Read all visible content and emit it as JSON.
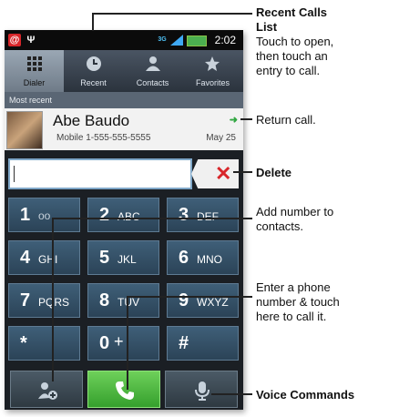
{
  "status_bar": {
    "time": "2:02",
    "network": "3G"
  },
  "tabs": [
    {
      "label": "Dialer",
      "icon": "dialpad-icon",
      "active": true
    },
    {
      "label": "Recent",
      "icon": "clock-icon",
      "active": false
    },
    {
      "label": "Contacts",
      "icon": "person-icon",
      "active": false
    },
    {
      "label": "Favorites",
      "icon": "star-icon",
      "active": false
    }
  ],
  "recent_header": "Most recent",
  "call_entry": {
    "name": "Abe Baudo",
    "detail": "Mobile 1-555-555-5555",
    "date": "May 25"
  },
  "keypad": [
    {
      "digit": "1",
      "letters": ""
    },
    {
      "digit": "2",
      "letters": "ABC"
    },
    {
      "digit": "3",
      "letters": "DEF"
    },
    {
      "digit": "4",
      "letters": "GHI"
    },
    {
      "digit": "5",
      "letters": "JKL"
    },
    {
      "digit": "6",
      "letters": "MNO"
    },
    {
      "digit": "7",
      "letters": "PQRS"
    },
    {
      "digit": "8",
      "letters": "TUV"
    },
    {
      "digit": "9",
      "letters": "WXYZ"
    },
    {
      "digit": "*",
      "letters": ""
    },
    {
      "digit": "0",
      "letters": "+"
    },
    {
      "digit": "#",
      "letters": ""
    }
  ],
  "annotations": {
    "recent_title": "Recent Calls List",
    "recent_body": "Touch to open, then touch an entry to call.",
    "return_call": "Return call.",
    "delete": "Delete",
    "add_number": "Add number to contacts.",
    "enter_number": "Enter a phone number & touch here to call it.",
    "voice": "Voice Commands"
  },
  "colors": {
    "call_green": "#35a02d",
    "delete_red": "#d8262a",
    "keypad_blue": "#2b4357"
  }
}
